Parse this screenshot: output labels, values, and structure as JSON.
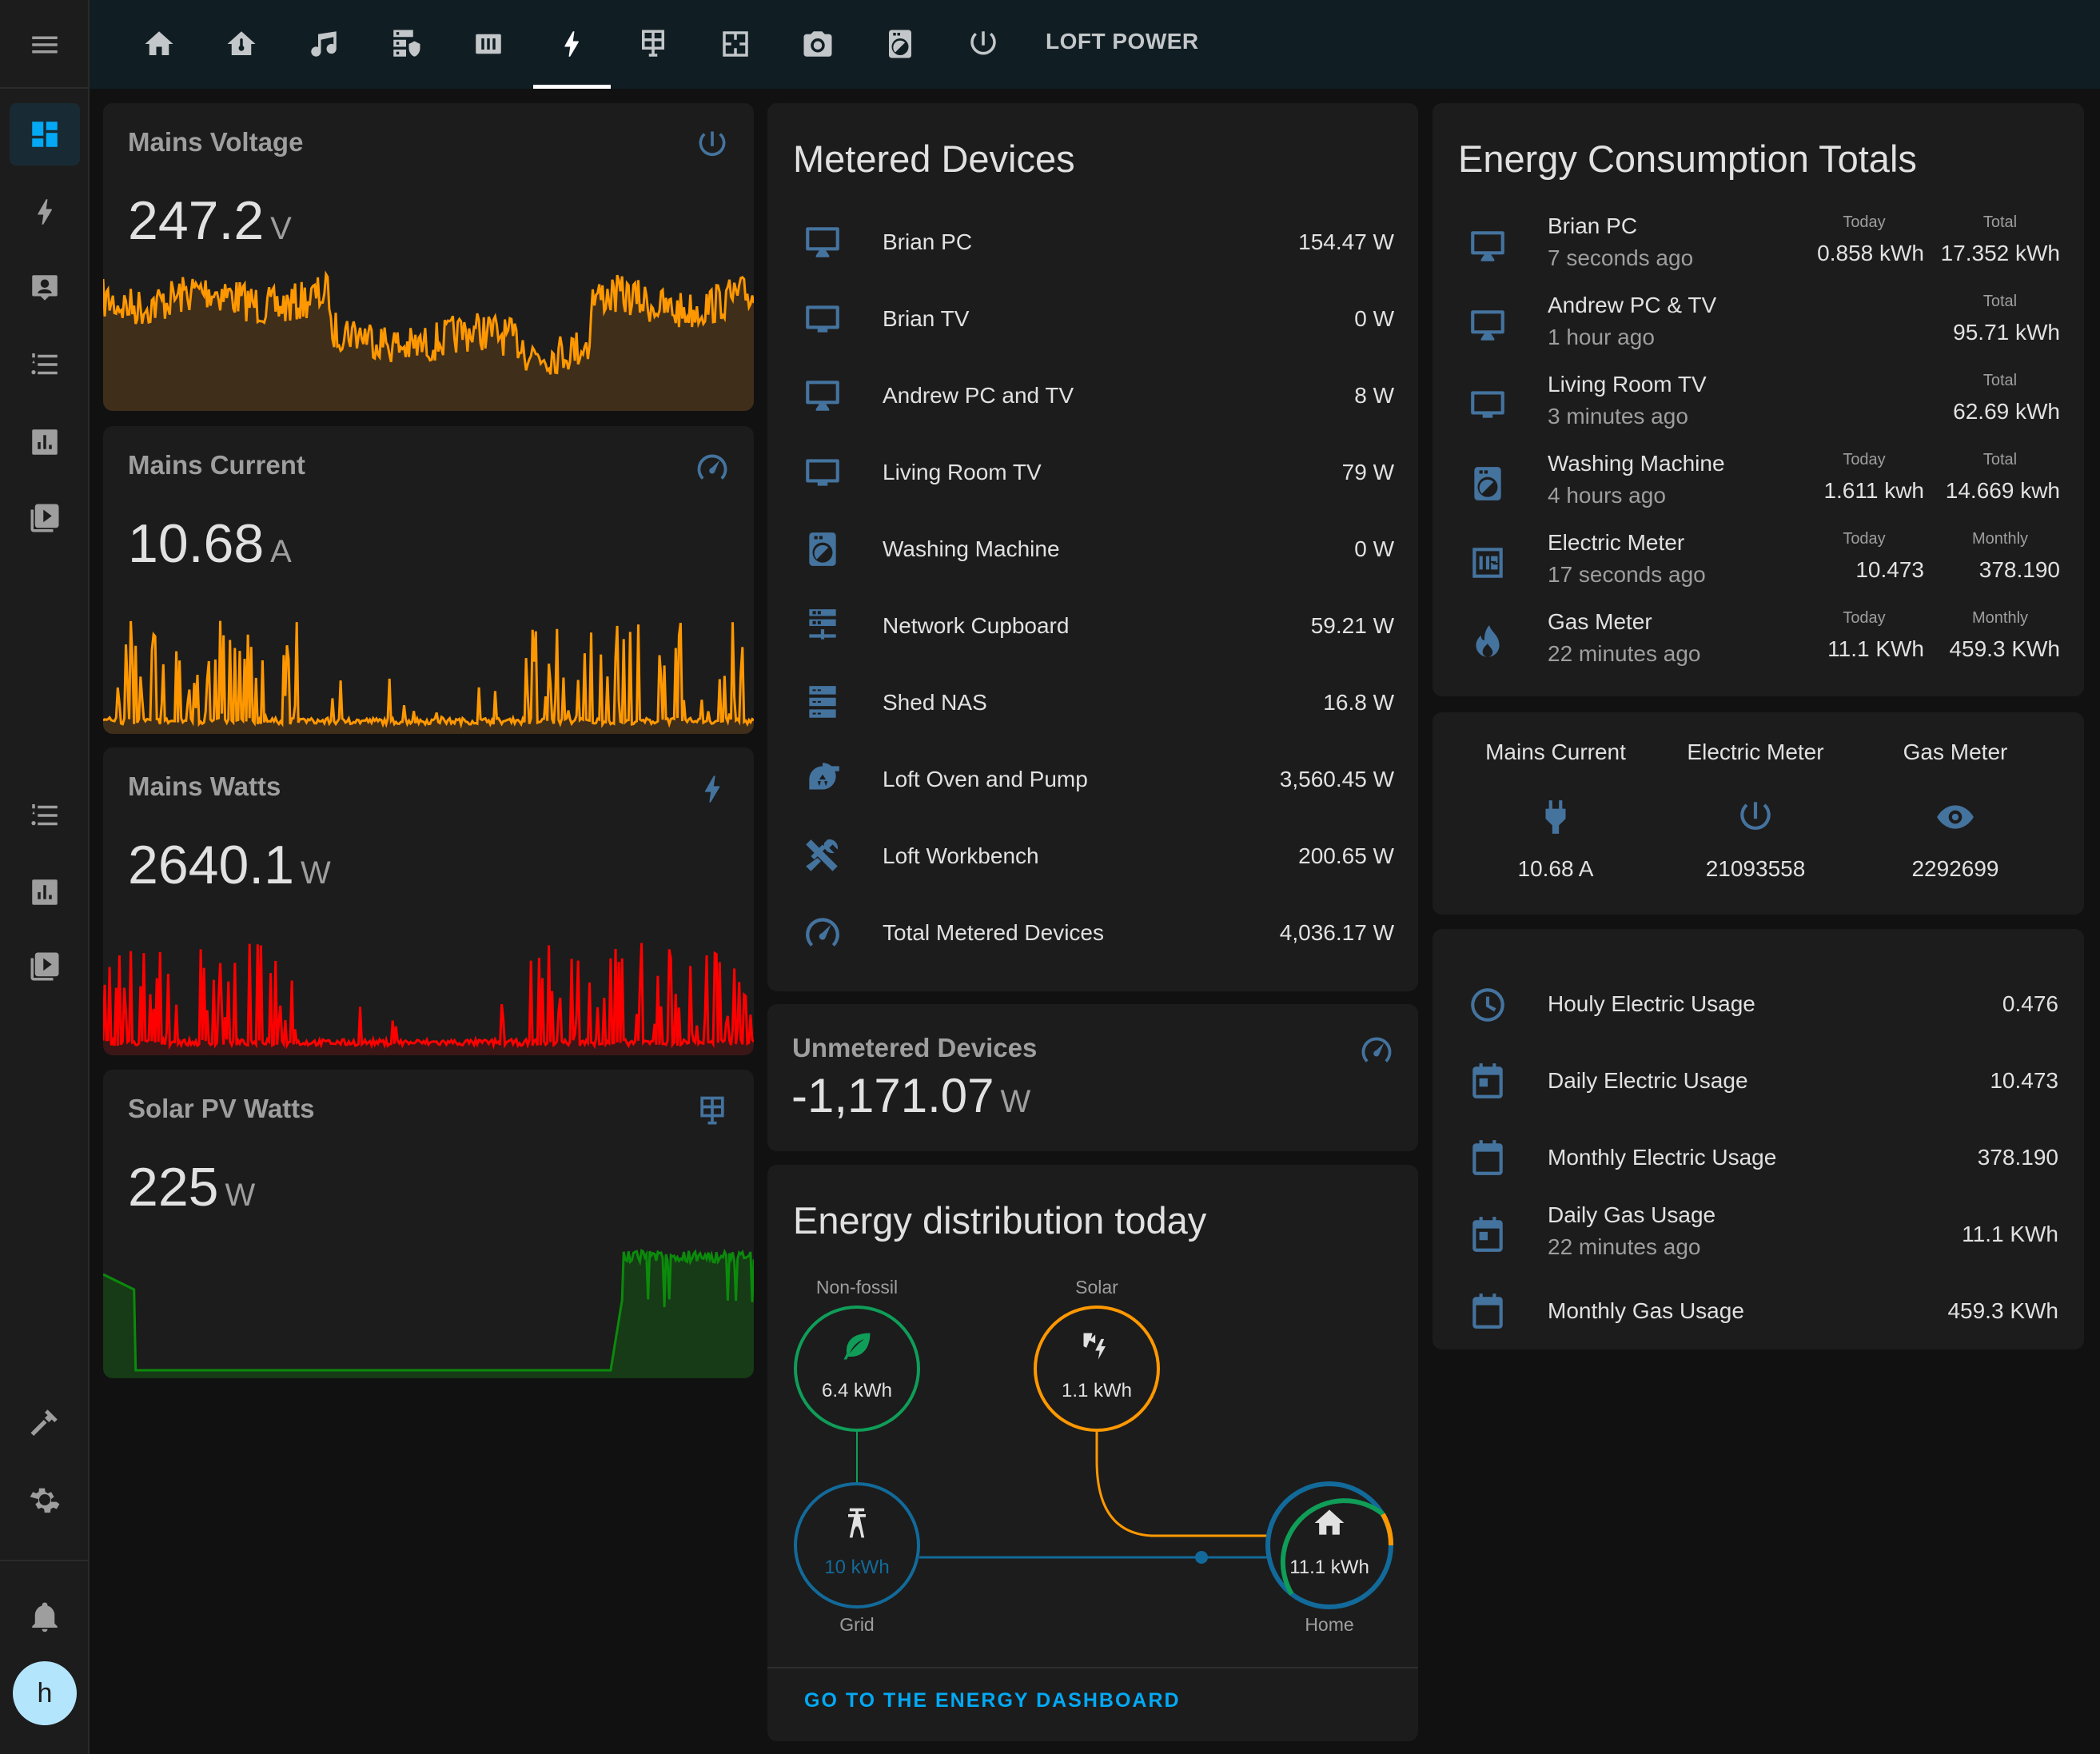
{
  "topbar": {
    "title": "LOFT POWER",
    "tabs": [
      "home-icon",
      "home-thermometer-icon",
      "music-icon",
      "server-security-icon",
      "radiator-icon",
      "lightning-icon",
      "solar-panel-icon",
      "floor-plan-icon",
      "camera-icon",
      "washing-machine-icon",
      "power-icon"
    ],
    "active_tab": "lightning-icon"
  },
  "sidebar": {
    "items": [
      "dashboard-icon",
      "lightning-icon",
      "account-box-icon",
      "format-list-icon",
      "chart-box-icon",
      "play-box-icon",
      "format-list-icon",
      "chart-box-icon",
      "play-box-icon",
      "hammer-icon",
      "cog-icon"
    ],
    "active": "dashboard-icon",
    "avatar_letter": "h"
  },
  "sensors": [
    {
      "title": "Mains Voltage",
      "value": "247.2",
      "unit": "V",
      "icon": "power-icon",
      "line_color": "#ff9800",
      "fill_color": "#3f2e1a"
    },
    {
      "title": "Mains Current",
      "value": "10.68",
      "unit": "A",
      "icon": "gauge-icon",
      "line_color": "#ff9800",
      "fill_color": "#3f2e1a"
    },
    {
      "title": "Mains Watts",
      "value": "2640.1",
      "unit": "W",
      "icon": "lightning-icon",
      "line_color": "#ff0000",
      "fill_color": "#3a1616"
    },
    {
      "title": "Solar PV Watts",
      "value": "225",
      "unit": "W",
      "icon": "solar-panel-icon",
      "line_color": "#0b8a0b",
      "fill_color": "#173a17"
    }
  ],
  "metered": {
    "title": "Metered Devices",
    "rows": [
      {
        "name": "Brian PC",
        "value": "154.47 W",
        "icon": "monitor-icon"
      },
      {
        "name": "Brian TV",
        "value": "0 W",
        "icon": "television-icon"
      },
      {
        "name": "Andrew PC and TV",
        "value": "8 W",
        "icon": "monitor-icon"
      },
      {
        "name": "Living Room TV",
        "value": "79 W",
        "icon": "television-icon"
      },
      {
        "name": "Washing Machine",
        "value": "0 W",
        "icon": "washing-machine-icon"
      },
      {
        "name": "Network Cupboard",
        "value": "59.21 W",
        "icon": "server-network-icon"
      },
      {
        "name": "Shed NAS",
        "value": "16.8 W",
        "icon": "server-icon"
      },
      {
        "name": "Loft Oven and Pump",
        "value": "3,560.45 W",
        "icon": "pump-icon"
      },
      {
        "name": "Loft Workbench",
        "value": "200.65 W",
        "icon": "tools-icon"
      },
      {
        "name": "Total Metered Devices",
        "value": "4,036.17 W",
        "icon": "gauge-icon"
      }
    ]
  },
  "unmetered": {
    "title": "Unmetered Devices",
    "value": "-1,171.07",
    "unit": "W",
    "icon": "gauge-icon"
  },
  "distribution": {
    "title": "Energy distribution today",
    "nonfossil": {
      "label": "Non-fossil",
      "value": "6.4 kWh",
      "color": "#0f9d58"
    },
    "solar": {
      "label": "Solar",
      "value": "1.1 kWh",
      "color": "#ff9800"
    },
    "grid": {
      "label": "Grid",
      "value": "10 kWh",
      "color": "#126a9a"
    },
    "home": {
      "label": "Home",
      "value": "11.1 kWh"
    },
    "button": "GO TO THE ENERGY DASHBOARD"
  },
  "totals": {
    "title": "Energy Consumption Totals",
    "rows": [
      {
        "name": "Brian PC",
        "sub": "7 seconds ago",
        "icon": "monitor-icon",
        "cols": [
          {
            "label": "Today",
            "value": "0.858 kWh"
          },
          {
            "label": "Total",
            "value": "17.352 kWh"
          }
        ]
      },
      {
        "name": "Andrew PC & TV",
        "sub": "1 hour ago",
        "icon": "monitor-icon",
        "cols": [
          {
            "label": "Total",
            "value": "95.71 kWh"
          }
        ]
      },
      {
        "name": "Living Room TV",
        "sub": "3 minutes ago",
        "icon": "television-icon",
        "cols": [
          {
            "label": "Total",
            "value": "62.69 kWh"
          }
        ]
      },
      {
        "name": "Washing Machine",
        "sub": "4 hours ago",
        "icon": "washing-machine-icon",
        "cols": [
          {
            "label": "Today",
            "value": "1.611 kwh"
          },
          {
            "label": "Total",
            "value": "14.669 kwh"
          }
        ]
      },
      {
        "name": "Electric Meter",
        "sub": "17 seconds ago",
        "icon": "numeric-icon",
        "cols": [
          {
            "label": "Today",
            "value": "10.473"
          },
          {
            "label": "Monthly",
            "value": "378.190"
          }
        ]
      },
      {
        "name": "Gas Meter",
        "sub": "22 minutes ago",
        "icon": "fire-icon",
        "cols": [
          {
            "label": "Today",
            "value": "11.1 KWh"
          },
          {
            "label": "Monthly",
            "value": "459.3 KWh"
          }
        ]
      }
    ]
  },
  "glance": [
    {
      "name": "Mains Current",
      "value": "10.68 A",
      "icon": "power-plug-icon"
    },
    {
      "name": "Electric Meter",
      "value": "21093558",
      "icon": "power-icon"
    },
    {
      "name": "Gas Meter",
      "value": "2292699",
      "icon": "eye-icon"
    }
  ],
  "usage": [
    {
      "name": "Houly Electric Usage",
      "value": "0.476",
      "icon": "clock-icon"
    },
    {
      "name": "Daily Electric Usage",
      "value": "10.473",
      "icon": "calendar-today-icon"
    },
    {
      "name": "Monthly Electric Usage",
      "value": "378.190",
      "icon": "calendar-blank-icon"
    },
    {
      "name": "Daily Gas Usage",
      "sub": "22 minutes ago",
      "value": "11.1 KWh",
      "icon": "calendar-today-icon"
    },
    {
      "name": "Monthly Gas Usage",
      "value": "459.3 KWh",
      "icon": "calendar-blank-icon"
    }
  ]
}
